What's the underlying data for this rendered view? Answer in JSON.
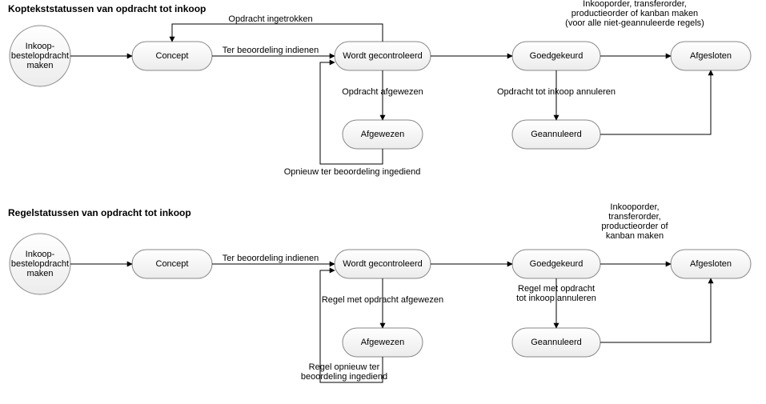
{
  "top": {
    "title": "Koptekststatussen van opdracht tot inkoop",
    "nodes": {
      "start": {
        "label": "Inkoop-\nbestelopdracht\nmaken"
      },
      "concept": {
        "label": "Concept"
      },
      "review": {
        "label": "Wordt gecontroleerd"
      },
      "approved": {
        "label": "Goedgekeurd"
      },
      "closed": {
        "label": "Afgesloten"
      },
      "rejected": {
        "label": "Afgewezen"
      },
      "canceled": {
        "label": "Geannuleerd"
      }
    },
    "edges": {
      "start_concept": "",
      "concept_review": "Ter beoordeling indienen",
      "review_concept": "Opdracht ingetrokken",
      "review_approved": "",
      "approved_closed": "Inkooporder, transferorder,\nproductieorder of kanban maken\n(voor alle niet-geannuleerde regels)",
      "review_rejected": "Opdracht afgewezen",
      "rejected_review": "Opnieuw ter beoordeling ingediend",
      "approved_canceled": "Opdracht tot inkoop annuleren",
      "canceled_closed": ""
    }
  },
  "bottom": {
    "title": "Regelstatussen van opdracht tot inkoop",
    "nodes": {
      "start": {
        "label": "Inkoop-\nbestelopdracht\nmaken"
      },
      "concept": {
        "label": "Concept"
      },
      "review": {
        "label": "Wordt gecontroleerd"
      },
      "approved": {
        "label": "Goedgekeurd"
      },
      "closed": {
        "label": "Afgesloten"
      },
      "rejected": {
        "label": "Afgewezen"
      },
      "canceled": {
        "label": "Geannuleerd"
      }
    },
    "edges": {
      "start_concept": "",
      "concept_review": "Ter beoordeling indienen",
      "review_approved": "",
      "approved_closed": "Inkooporder,\ntransferorder,\nproductieorder of\nkanban maken",
      "review_rejected": "Regel met opdracht afgewezen",
      "rejected_review": "Regel opnieuw ter\nbeoordeling ingediend",
      "approved_canceled": "Regel met opdracht\ntot inkoop annuleren",
      "canceled_closed": ""
    }
  }
}
